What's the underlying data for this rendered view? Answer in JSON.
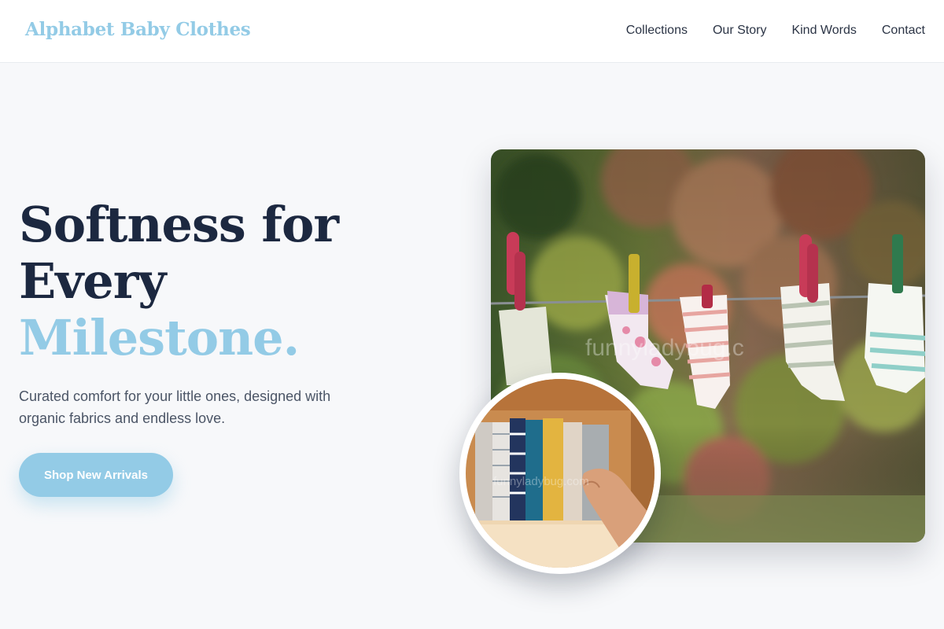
{
  "header": {
    "brand": "Alphabet Baby Clothes",
    "nav": [
      {
        "label": "Collections"
      },
      {
        "label": "Our Story"
      },
      {
        "label": "Kind Words"
      },
      {
        "label": "Contact"
      }
    ]
  },
  "hero": {
    "headline_line1": "Softness for",
    "headline_line2": "Every",
    "headline_accent": "Milestone.",
    "subtitle": "Curated comfort for your little ones, designed with organic fabrics and endless love.",
    "cta_label": "Shop New Arrivals"
  },
  "images": {
    "main": {
      "icon": "socks-on-clothesline-photo",
      "watermark": "funnyladybug.c"
    },
    "thumb": {
      "icon": "folded-clothes-drawer-photo",
      "watermark": "funnyladybug.com"
    }
  },
  "colors": {
    "accent": "#93cbe6",
    "headline": "#1c2840",
    "background": "#f7f8fa"
  }
}
